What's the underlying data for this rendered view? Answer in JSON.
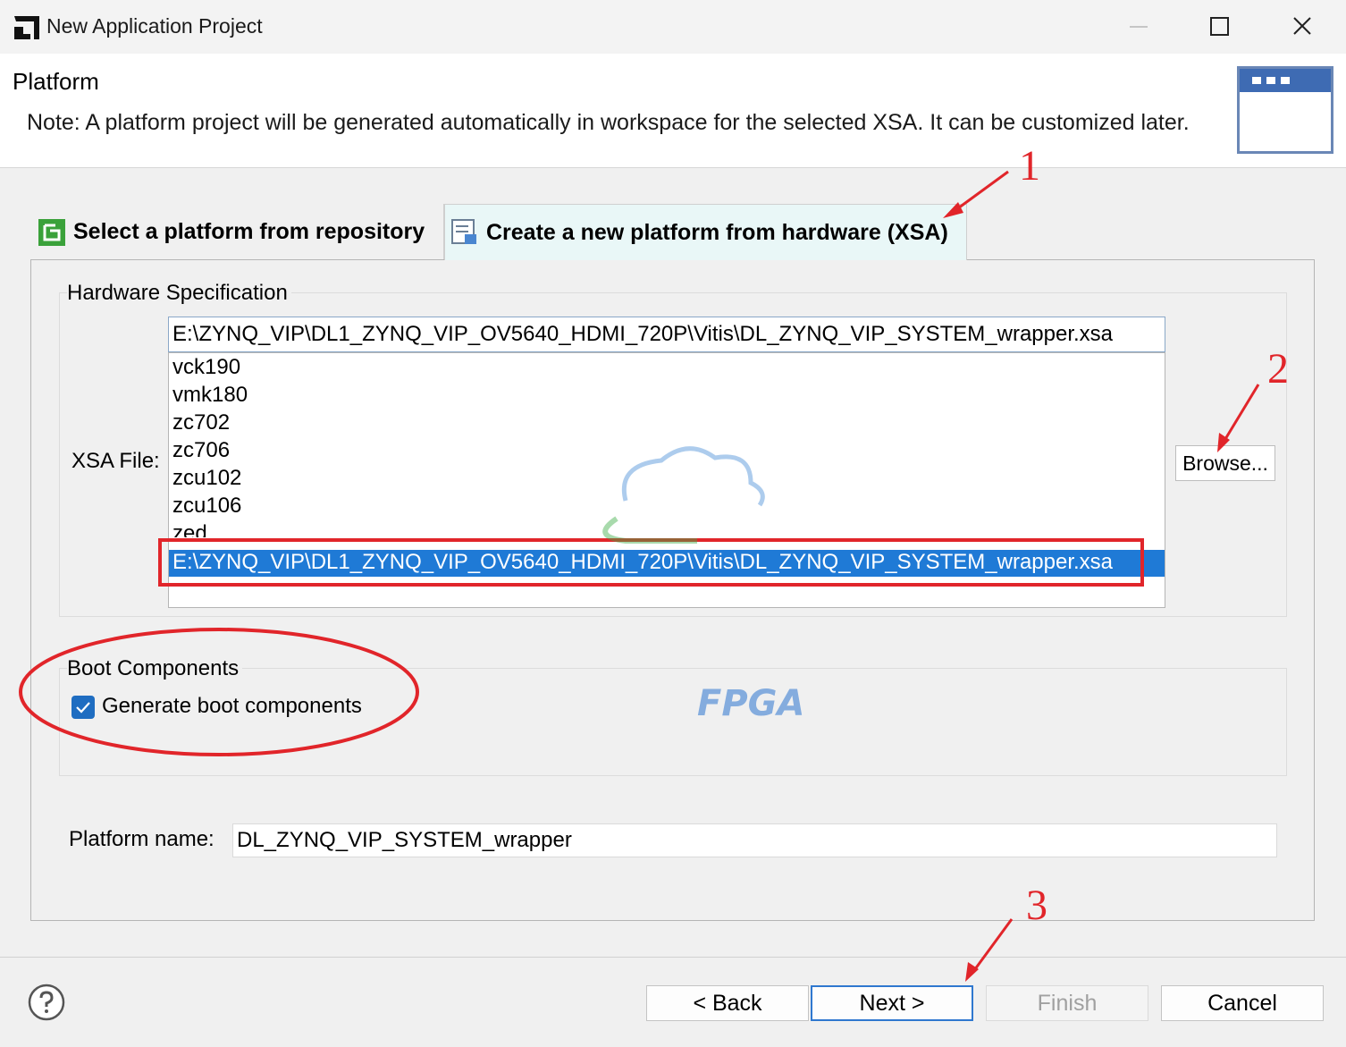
{
  "window": {
    "title": "New Application Project",
    "icon": "amd-logo-icon"
  },
  "header": {
    "title": "Platform",
    "note": "Note: A platform project will be generated automatically in workspace for the selected XSA. It can be customized later."
  },
  "tabs": [
    {
      "label": "Select a platform from repository",
      "icon": "platform-repo-icon",
      "active": false
    },
    {
      "label": "Create a new platform from hardware (XSA)",
      "icon": "hardware-xsa-icon",
      "active": true
    }
  ],
  "hardware_spec": {
    "group_label": "Hardware Specification",
    "xsa_label": "XSA File:",
    "xsa_value": "E:\\ZYNQ_VIP\\DL1_ZYNQ_VIP_OV5640_HDMI_720P\\Vitis\\DL_ZYNQ_VIP_SYSTEM_wrapper.xsa",
    "options": [
      "vck190",
      "vmk180",
      "zc702",
      "zc706",
      "zcu102",
      "zcu106",
      "zed"
    ],
    "selected_option": "E:\\ZYNQ_VIP\\DL1_ZYNQ_VIP_OV5640_HDMI_720P\\Vitis\\DL_ZYNQ_VIP_SYSTEM_wrapper.xsa",
    "browse_label": "Browse..."
  },
  "boot": {
    "group_label": "Boot Components",
    "checkbox_label": "Generate boot components",
    "checked": true
  },
  "platform_name": {
    "label": "Platform name:",
    "value": "DL_ZYNQ_VIP_SYSTEM_wrapper"
  },
  "footer": {
    "back": "< Back",
    "next": "Next >",
    "finish": "Finish",
    "cancel": "Cancel",
    "help_icon": "help-icon"
  },
  "annotations": [
    "1",
    "2",
    "3"
  ],
  "watermark": "FPGA",
  "colors": {
    "accent": "#1f7ad6",
    "annotation_red": "#e1252a",
    "tab_active_bg": "#e9f7f7"
  }
}
